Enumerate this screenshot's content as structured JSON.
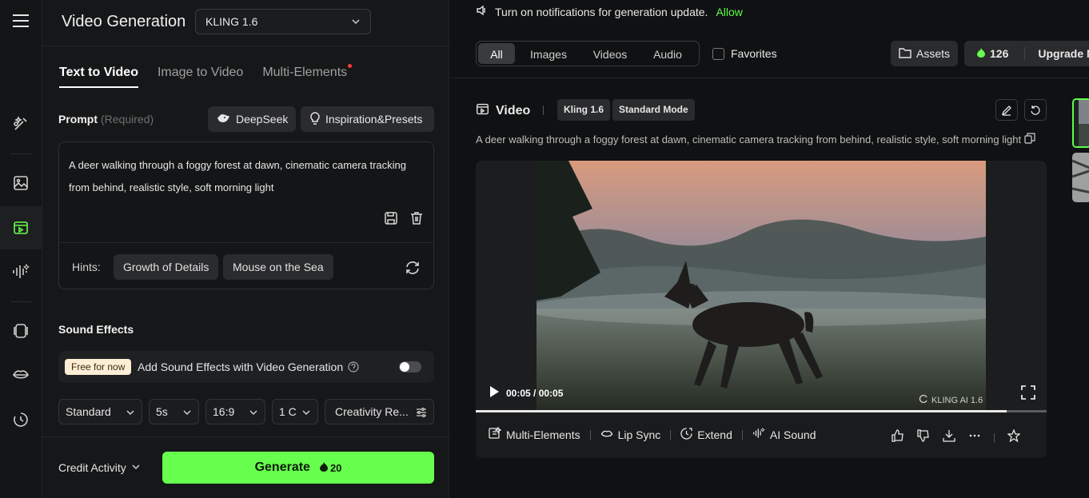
{
  "panel": {
    "title": "Video Generation",
    "model": "KLING 1.6",
    "tabs": [
      {
        "label": "Text to Video",
        "active": true
      },
      {
        "label": "Image to Video",
        "active": false
      },
      {
        "label": "Multi-Elements",
        "active": false,
        "dot": true
      }
    ],
    "prompt": {
      "label": "Prompt",
      "required": "(Required)",
      "deepseek": "DeepSeek",
      "inspiration": "Inspiration&Presets",
      "text": "A deer walking through a foggy forest at dawn, cinematic camera tracking from behind, realistic style, soft morning light"
    },
    "hints": {
      "label": "Hints:",
      "items": [
        "Growth of Details",
        "Mouse on the Sea"
      ]
    },
    "sound_effects": {
      "title": "Sound Effects",
      "badge": "Free for now",
      "text": "Add Sound Effects with Video Generation",
      "enabled": false
    },
    "options": {
      "mode": "Standard",
      "duration": "5s",
      "ratio": "16:9",
      "count": "1 C",
      "creativity": "Creativity Re..."
    },
    "credit_activity": "Credit Activity",
    "generate_label": "Generate",
    "generate_cost": "20"
  },
  "main": {
    "notification": "Turn on notifications for generation update.",
    "allow": "Allow",
    "filters": [
      "All",
      "Images",
      "Videos",
      "Audio"
    ],
    "active_filter": "All",
    "favorites": "Favorites",
    "assets": "Assets",
    "credits": "126",
    "upgrade": "Upgrade N",
    "video": {
      "title": "Video",
      "model_tag": "Kling 1.6",
      "mode_tag": "Standard Mode",
      "prompt": "A deer walking through a foggy forest at dawn, cinematic camera tracking from behind, realistic style, soft morning light",
      "time": "00:05 / 00:05",
      "watermark": "KLING AI 1.6",
      "progress": 0.93
    },
    "actions": [
      "Multi-Elements",
      "Lip Sync",
      "Extend",
      "AI Sound"
    ]
  },
  "colors": {
    "accent": "#66ff4d",
    "allow": "#5dff4a",
    "badge_bg": "#fbeed5"
  }
}
